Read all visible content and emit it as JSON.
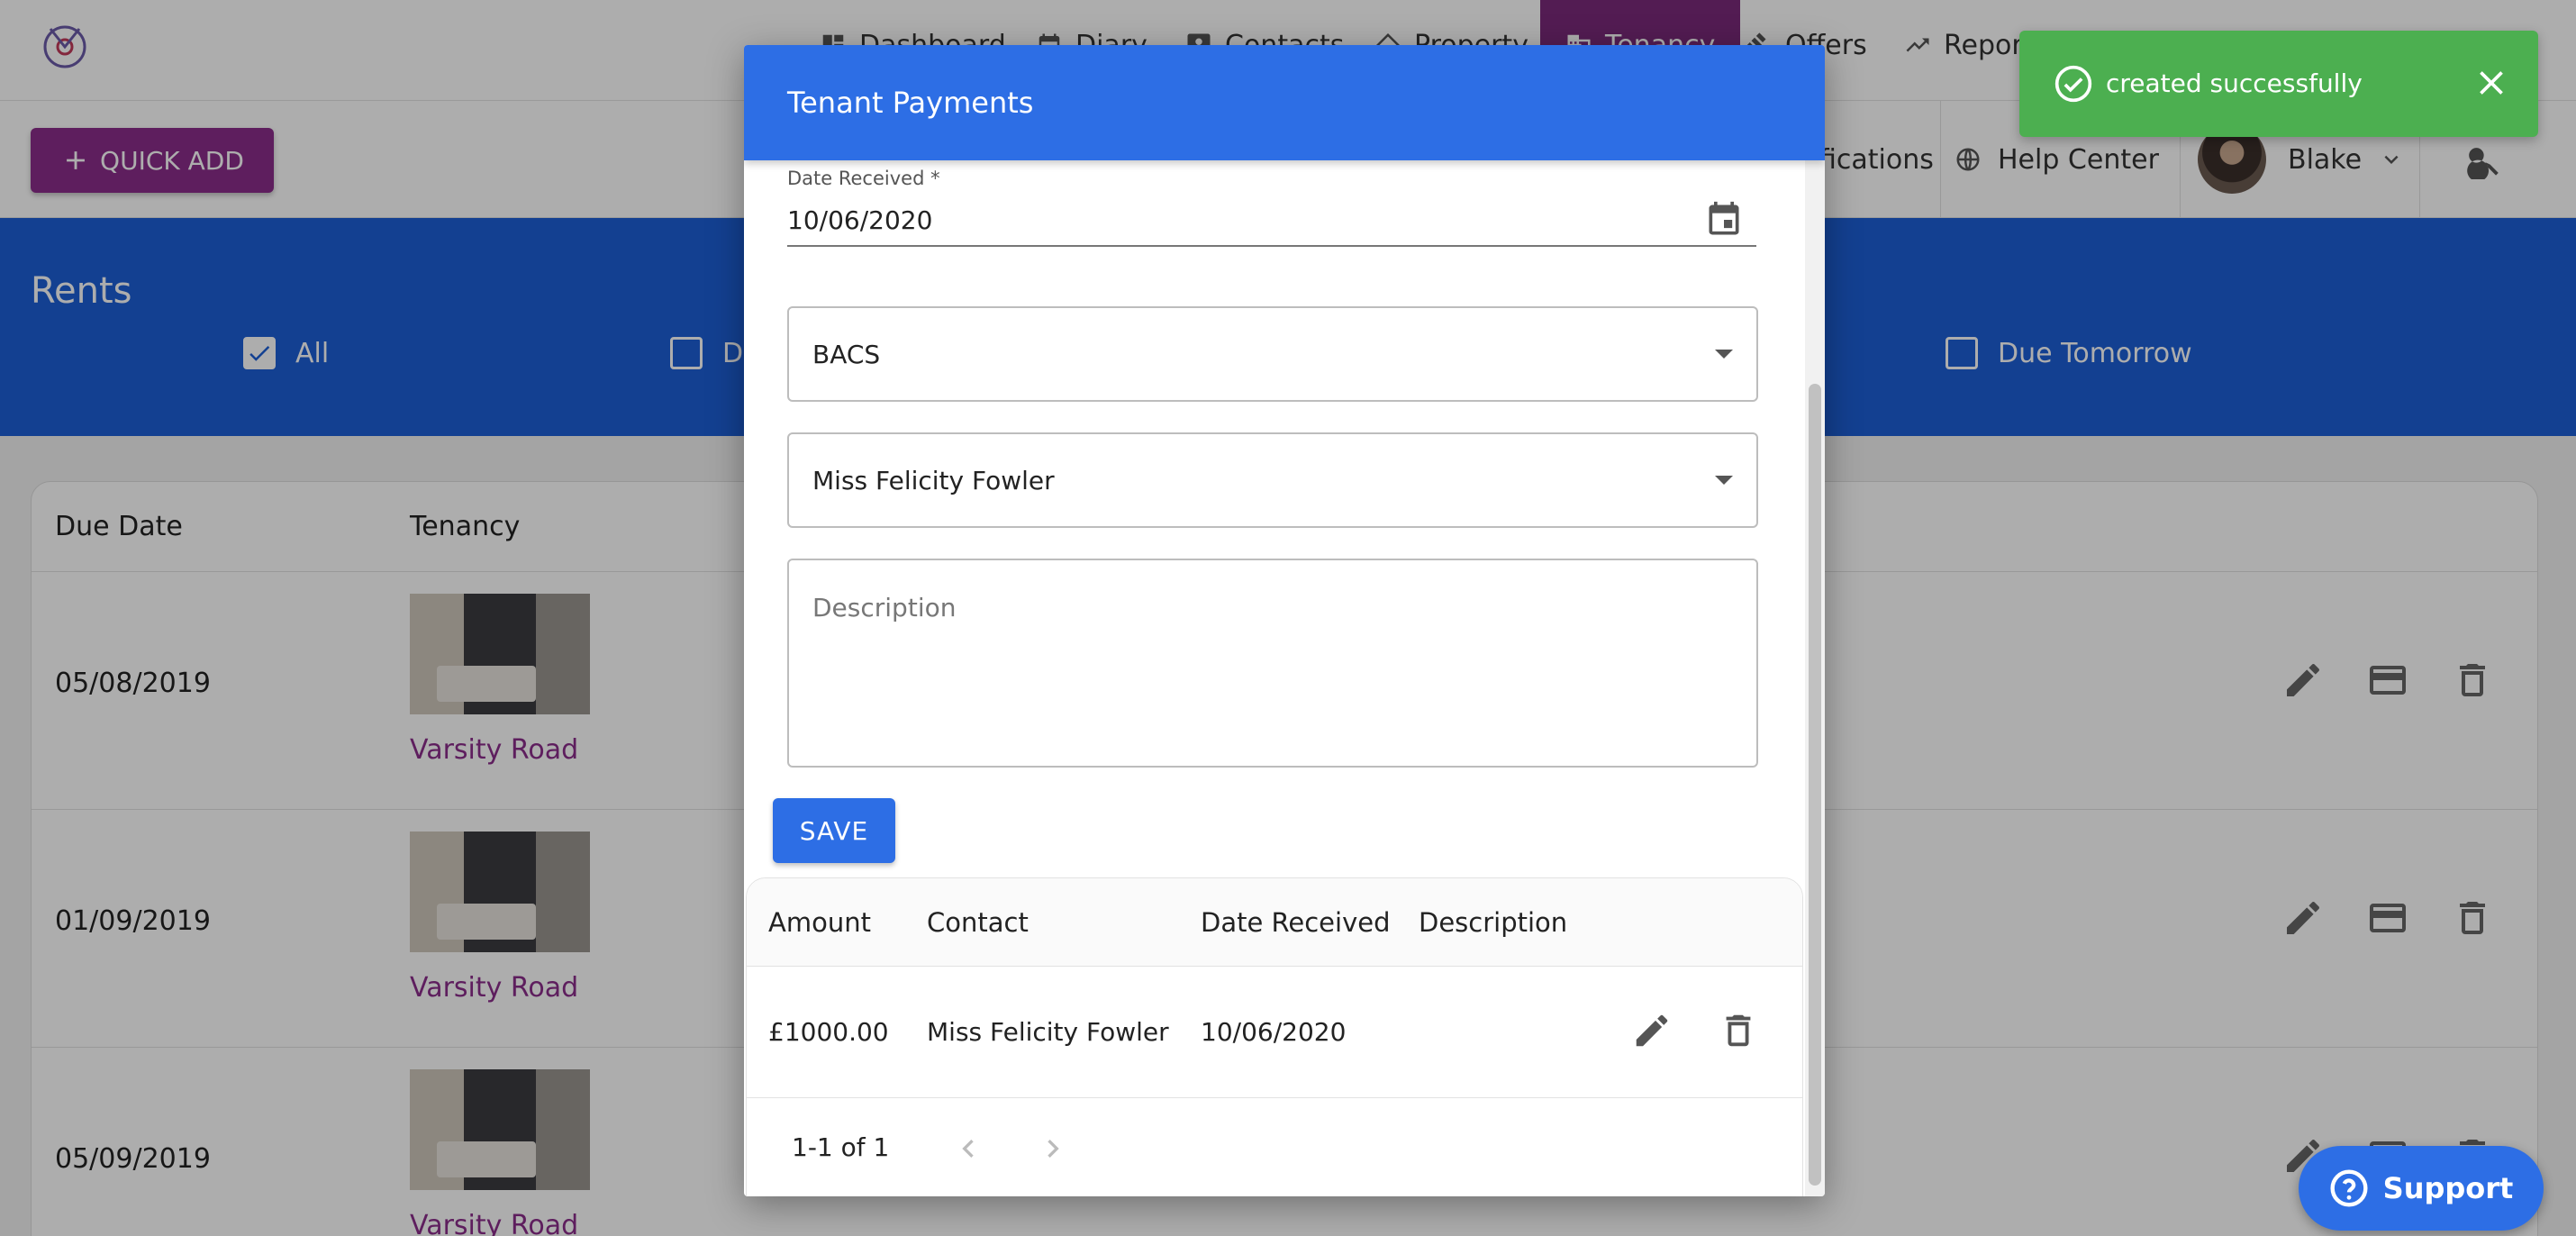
{
  "nav": {
    "items": [
      {
        "label": "Dashboard",
        "icon": "dashboard-icon"
      },
      {
        "label": "Diary",
        "icon": "calendar-icon"
      },
      {
        "label": "Contacts",
        "icon": "contacts-icon"
      },
      {
        "label": "Property",
        "icon": "home-icon"
      },
      {
        "label": "Tenancy",
        "icon": "building-icon"
      },
      {
        "label": "Offers",
        "icon": "gavel-icon"
      },
      {
        "label": "Repor",
        "icon": "trending-icon"
      }
    ]
  },
  "toolbar": {
    "quick_add": "QUICK ADD",
    "notifications": "fications",
    "help_center": "Help Center",
    "user_name": "Blake"
  },
  "banner": {
    "title": "Rents",
    "filters": [
      {
        "label": "All",
        "checked": true
      },
      {
        "label": "D",
        "checked": false
      },
      {
        "label": "Due Tomorrow",
        "checked": false
      }
    ]
  },
  "rents_table": {
    "headers": [
      "Due Date",
      "Tenancy"
    ],
    "rows": [
      {
        "due_date": "05/08/2019",
        "address": "Varsity Road"
      },
      {
        "due_date": "01/09/2019",
        "address": "Varsity Road"
      },
      {
        "due_date": "05/09/2019",
        "address": "Varsity Road"
      }
    ]
  },
  "modal": {
    "title": "Tenant Payments",
    "date_label": "Date Received *",
    "date_value": "10/06/2020",
    "method_value": "BACS",
    "contact_value": "Miss Felicity Fowler",
    "description_placeholder": "Description",
    "save_label": "SAVE",
    "table": {
      "headers": [
        "Amount",
        "Contact",
        "Date Received",
        "Description"
      ],
      "rows": [
        {
          "amount": "£1000.00",
          "contact": "Miss Felicity Fowler",
          "date": "10/06/2020",
          "description": ""
        }
      ],
      "pagination": "1-1 of 1"
    }
  },
  "toast": {
    "message": "created successfully",
    "color": "#4caf50"
  },
  "support": {
    "label": "Support"
  },
  "colors": {
    "primary_blue": "#2d6ee5",
    "banner_blue": "#1c5fd6",
    "brand_purple": "#8b2d8b"
  }
}
